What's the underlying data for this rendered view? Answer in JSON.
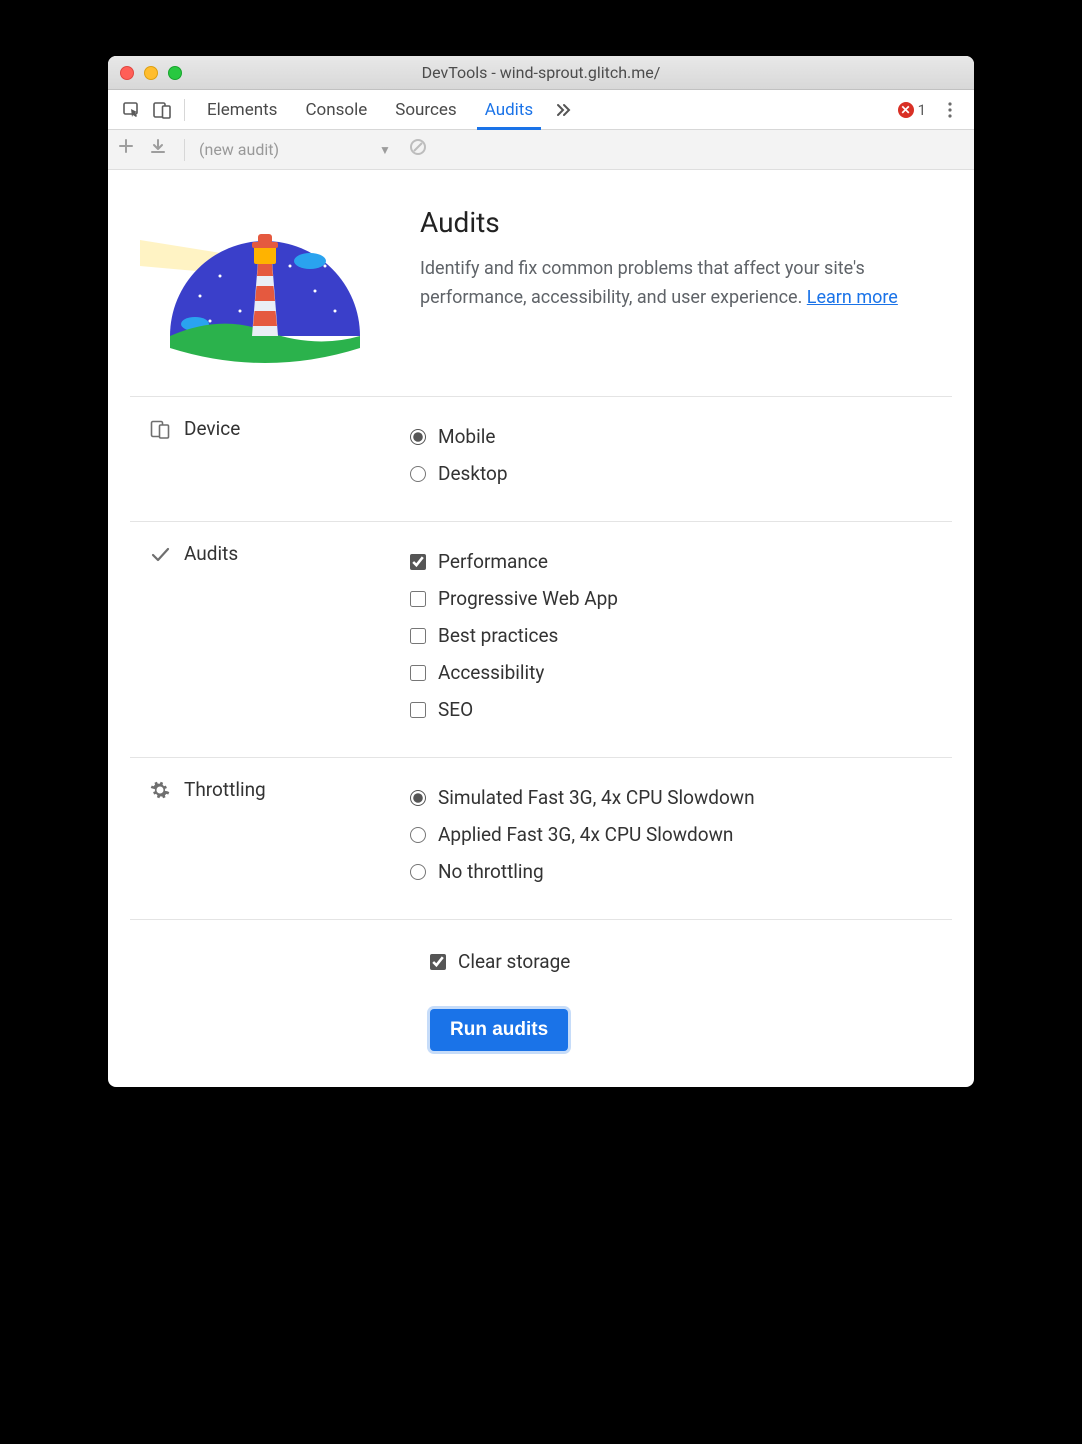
{
  "window": {
    "title": "DevTools - wind-sprout.glitch.me/"
  },
  "tabs": {
    "items": [
      "Elements",
      "Console",
      "Sources",
      "Audits"
    ],
    "active_index": 3,
    "error_count": "1"
  },
  "toolbar": {
    "new_audit_label": "(new audit)"
  },
  "intro": {
    "heading": "Audits",
    "body": "Identify and fix common problems that affect your site's performance, accessibility, and user experience. ",
    "learn_more": "Learn more"
  },
  "sections": {
    "device": {
      "label": "Device",
      "options": [
        {
          "label": "Mobile",
          "checked": true
        },
        {
          "label": "Desktop",
          "checked": false
        }
      ]
    },
    "audits": {
      "label": "Audits",
      "options": [
        {
          "label": "Performance",
          "checked": true
        },
        {
          "label": "Progressive Web App",
          "checked": false
        },
        {
          "label": "Best practices",
          "checked": false
        },
        {
          "label": "Accessibility",
          "checked": false
        },
        {
          "label": "SEO",
          "checked": false
        }
      ]
    },
    "throttling": {
      "label": "Throttling",
      "options": [
        {
          "label": "Simulated Fast 3G, 4x CPU Slowdown",
          "checked": true
        },
        {
          "label": "Applied Fast 3G, 4x CPU Slowdown",
          "checked": false
        },
        {
          "label": "No throttling",
          "checked": false
        }
      ]
    }
  },
  "clear_storage": {
    "label": "Clear storage",
    "checked": true
  },
  "run_button": "Run audits"
}
